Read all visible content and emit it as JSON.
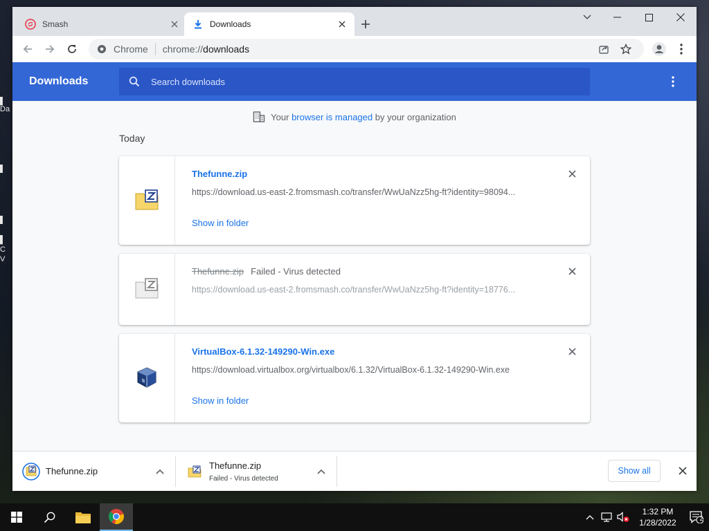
{
  "tabs": [
    {
      "title": "Smash",
      "active": false,
      "icon": "smash-logo-icon"
    },
    {
      "title": "Downloads",
      "active": true,
      "icon": "download-arrow-icon"
    }
  ],
  "omnibox": {
    "site_label": "Chrome",
    "url_scheme": "chrome://",
    "url_path": "downloads"
  },
  "downloads_page": {
    "title": "Downloads",
    "search_placeholder": "Search downloads",
    "managed": {
      "prefix": "Your ",
      "link": "browser is managed",
      "suffix": " by your organization"
    },
    "section": "Today",
    "items": [
      {
        "name": "Thefunne.zip",
        "status": "",
        "url": "https://download.us-east-2.fromsmash.co/transfer/WwUaNzz5hg-ft?identity=98094...",
        "action": "Show in folder",
        "icon": "zip-file-icon"
      },
      {
        "name": "Thefunne.zip",
        "status": "Failed - Virus detected",
        "url": "https://download.us-east-2.fromsmash.co/transfer/WwUaNzz5hg-ft?identity=18776...",
        "action": "",
        "icon": "zip-file-gray-icon"
      },
      {
        "name": "VirtualBox-6.1.32-149290-Win.exe",
        "status": "",
        "url": "https://download.virtualbox.org/virtualbox/6.1.32/VirtualBox-6.1.32-149290-Win.exe",
        "action": "Show in folder",
        "icon": "virtualbox-icon"
      }
    ]
  },
  "shelf": {
    "items": [
      {
        "name": "Thefunne.zip",
        "status": ""
      },
      {
        "name": "Thefunne.zip",
        "status": "Failed - Virus detected"
      }
    ],
    "show_all": "Show all"
  },
  "taskbar": {
    "time": "1:32 PM",
    "date": "1/28/2022",
    "notification_count": "2"
  },
  "colors": {
    "header_blue": "#3367d6",
    "search_blue": "#2a56c6",
    "link_blue": "#1a73e8"
  }
}
